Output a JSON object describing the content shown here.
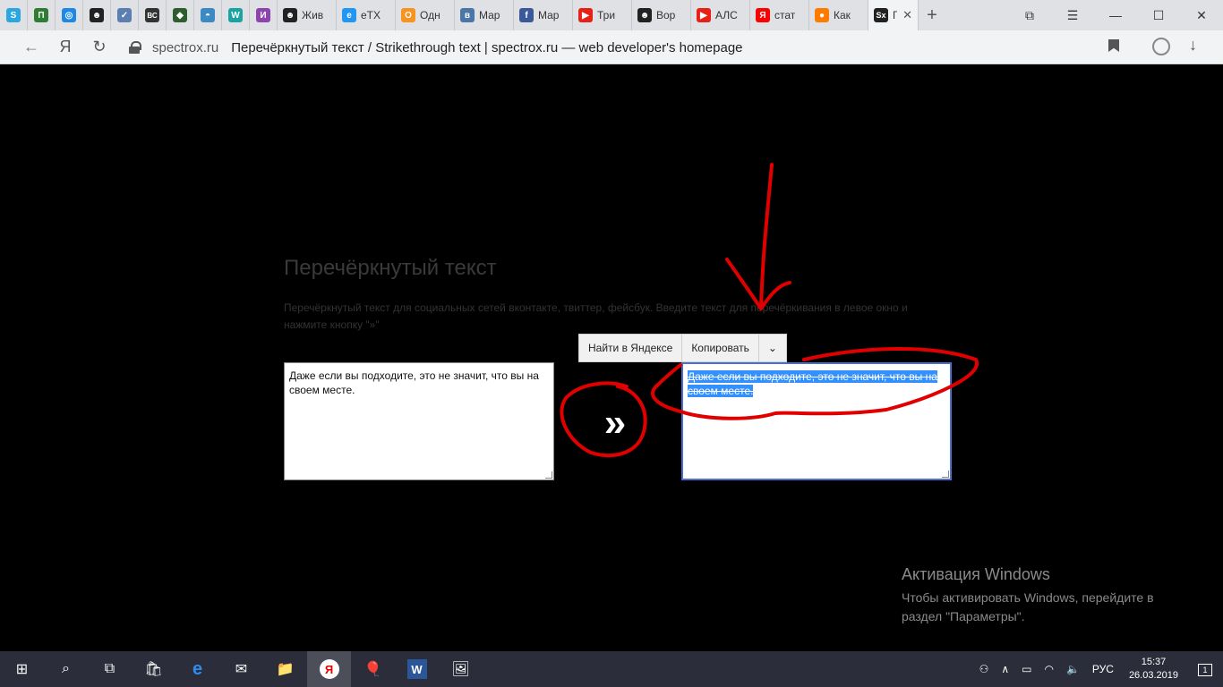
{
  "tabs": [
    {
      "label": "",
      "fav": "S",
      "color": "#2aa6e0"
    },
    {
      "label": "",
      "fav": "П",
      "color": "#2e7d32"
    },
    {
      "label": "",
      "fav": "◎",
      "color": "#1e88e5"
    },
    {
      "label": "",
      "fav": "☻",
      "color": "#222222"
    },
    {
      "label": "",
      "fav": "✓",
      "color": "#5a7fb0"
    },
    {
      "label": "",
      "fav": "ВС",
      "color": "#333333"
    },
    {
      "label": "",
      "fav": "◆",
      "color": "#2e5e2e"
    },
    {
      "label": "",
      "fav": "◓",
      "color": "#3b8ac4"
    },
    {
      "label": "",
      "fav": "W",
      "color": "#1aa3a3"
    },
    {
      "label": "",
      "fav": "И",
      "color": "#8e44ad"
    },
    {
      "label": "Жив",
      "fav": "☻",
      "color": "#222222"
    },
    {
      "label": "eTX",
      "fav": "e",
      "color": "#2196f3"
    },
    {
      "label": "Одн",
      "fav": "О",
      "color": "#f7931e"
    },
    {
      "label": "Мар",
      "fav": "в",
      "color": "#4a76a8"
    },
    {
      "label": "Мар",
      "fav": "f",
      "color": "#3b5998"
    },
    {
      "label": "Три",
      "fav": "▶",
      "color": "#e62117"
    },
    {
      "label": "Вор",
      "fav": "☻",
      "color": "#222222"
    },
    {
      "label": "АЛС",
      "fav": "▶",
      "color": "#e62117"
    },
    {
      "label": "стат",
      "fav": "Я",
      "color": "#ff0000"
    },
    {
      "label": "Как",
      "fav": "●",
      "color": "#ff7b00"
    }
  ],
  "active_tab": {
    "fav": "Sx",
    "label": "Г",
    "close": "✕"
  },
  "new_tab": "+",
  "window_controls": {
    "bookmarks": "⧉",
    "menu": "☰",
    "minimize": "—",
    "maximize": "☐",
    "close": "✕"
  },
  "nav": {
    "back": "←",
    "yandex": "Я",
    "reload": "↻"
  },
  "address": {
    "domain": "spectrox.ru",
    "title": "Перечёркнутый текст / Strikethrough text | spectrox.ru — web developer's homepage"
  },
  "page": {
    "title": "Перечёркнутый текст",
    "description": "Перечёркнутый текст для социальных сетей вконтакте, твиттер, фейсбук. Введите текст для перечёркивания в левое окно и нажмите кнопку \"»\"",
    "input_text": "Даже если вы подходите, это не значит, что вы на своем месте.",
    "output_text": "Даже если вы подходите, это не значит, что вы на своем месте.",
    "convert_button": "»"
  },
  "context_menu": {
    "search": "Найти в Яндексе",
    "copy": "Копировать",
    "more": "⌄"
  },
  "activation": {
    "heading": "Активация Windows",
    "text": "Чтобы активировать Windows, перейдите в раздел \"Параметры\"."
  },
  "taskbar": {
    "start": "⊞",
    "search": "⌕",
    "task_view": "⧉",
    "apps": [
      "🛍",
      "e",
      "✉",
      "📁",
      "Я",
      "🎈",
      "W",
      "🖼"
    ]
  },
  "tray": {
    "people": "⚇",
    "chevron": "∧",
    "battery": "▭",
    "wifi": "◠",
    "sound": "🔈",
    "lang": "РУС",
    "time": "15:37",
    "date": "26.03.2019",
    "notifications": "1"
  },
  "colors": {
    "selection": "#3390ff",
    "annotation": "#e00000",
    "taskbar": "#2b2e3a"
  }
}
